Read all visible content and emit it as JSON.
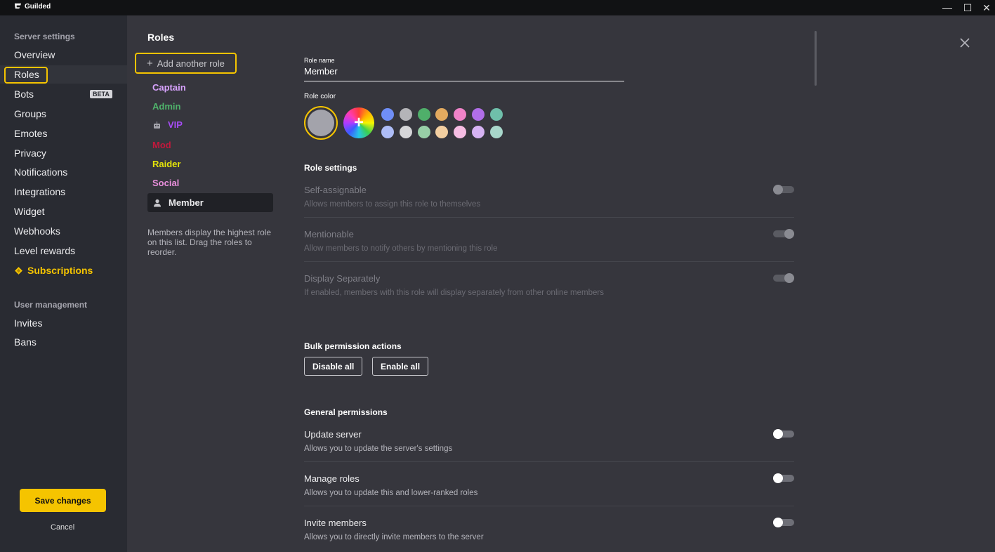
{
  "app": {
    "title": "Guilded"
  },
  "window_controls": {
    "minimize": "—",
    "maximize": "☐",
    "close": "✕"
  },
  "sidebar": {
    "heading": "Server settings",
    "items": [
      {
        "label": "Overview"
      },
      {
        "label": "Roles"
      },
      {
        "label": "Bots",
        "badge": "BETA"
      },
      {
        "label": "Groups"
      },
      {
        "label": "Emotes"
      },
      {
        "label": "Privacy"
      },
      {
        "label": "Notifications"
      },
      {
        "label": "Integrations"
      },
      {
        "label": "Widget"
      },
      {
        "label": "Webhooks"
      },
      {
        "label": "Level rewards"
      },
      {
        "label": "Subscriptions"
      }
    ],
    "heading2": "User management",
    "items2": [
      {
        "label": "Invites"
      },
      {
        "label": "Bans"
      }
    ],
    "save_label": "Save changes",
    "cancel_label": "Cancel"
  },
  "roles_panel": {
    "title": "Roles",
    "add_label": "Add another role",
    "roles": [
      {
        "name": "Captain",
        "color": "#d9a3ff"
      },
      {
        "name": "Admin",
        "color": "#4fb36b"
      },
      {
        "name": "VIP",
        "color": "#a64cf5"
      },
      {
        "name": "Mod",
        "color": "#c2183c"
      },
      {
        "name": "Raider",
        "color": "#e4e40a"
      },
      {
        "name": "Social",
        "color": "#e98fdc"
      },
      {
        "name": "Member",
        "color": "#ececee"
      }
    ],
    "note": "Members display the highest role on this list. Drag the roles to reorder."
  },
  "role_editor": {
    "name_label": "Role name",
    "name_value": "Member",
    "color_label": "Role color",
    "selected_color": "#a3a3ab",
    "palette_row1": [
      "#6f8ef7",
      "#b4b4b8",
      "#4faf6a",
      "#e3aa5f",
      "#f083c9",
      "#b06ee8",
      "#6fbfaa"
    ],
    "palette_row2": [
      "#aebdf7",
      "#d5d5d8",
      "#98cfa7",
      "#f3cfa1",
      "#f6bde3",
      "#d6b3f3",
      "#a8d7cb"
    ],
    "role_settings_heading": "Role settings",
    "role_settings": [
      {
        "title": "Self-assignable",
        "desc": "Allows members to assign this role to themselves",
        "on": false
      },
      {
        "title": "Mentionable",
        "desc": "Allow members to notify others by mentioning this role",
        "on": true
      },
      {
        "title": "Display Separately",
        "desc": "If enabled, members with this role will display separately from other online members",
        "on": true
      }
    ],
    "bulk_heading": "Bulk permission actions",
    "disable_all": "Disable all",
    "enable_all": "Enable all",
    "general_heading": "General permissions",
    "general": [
      {
        "title": "Update server",
        "desc": "Allows you to update the server's settings",
        "on": false
      },
      {
        "title": "Manage roles",
        "desc": "Allows you to update this and lower-ranked roles",
        "on": false
      },
      {
        "title": "Invite members",
        "desc": "Allows you to directly invite members to the server",
        "on": false
      }
    ]
  }
}
